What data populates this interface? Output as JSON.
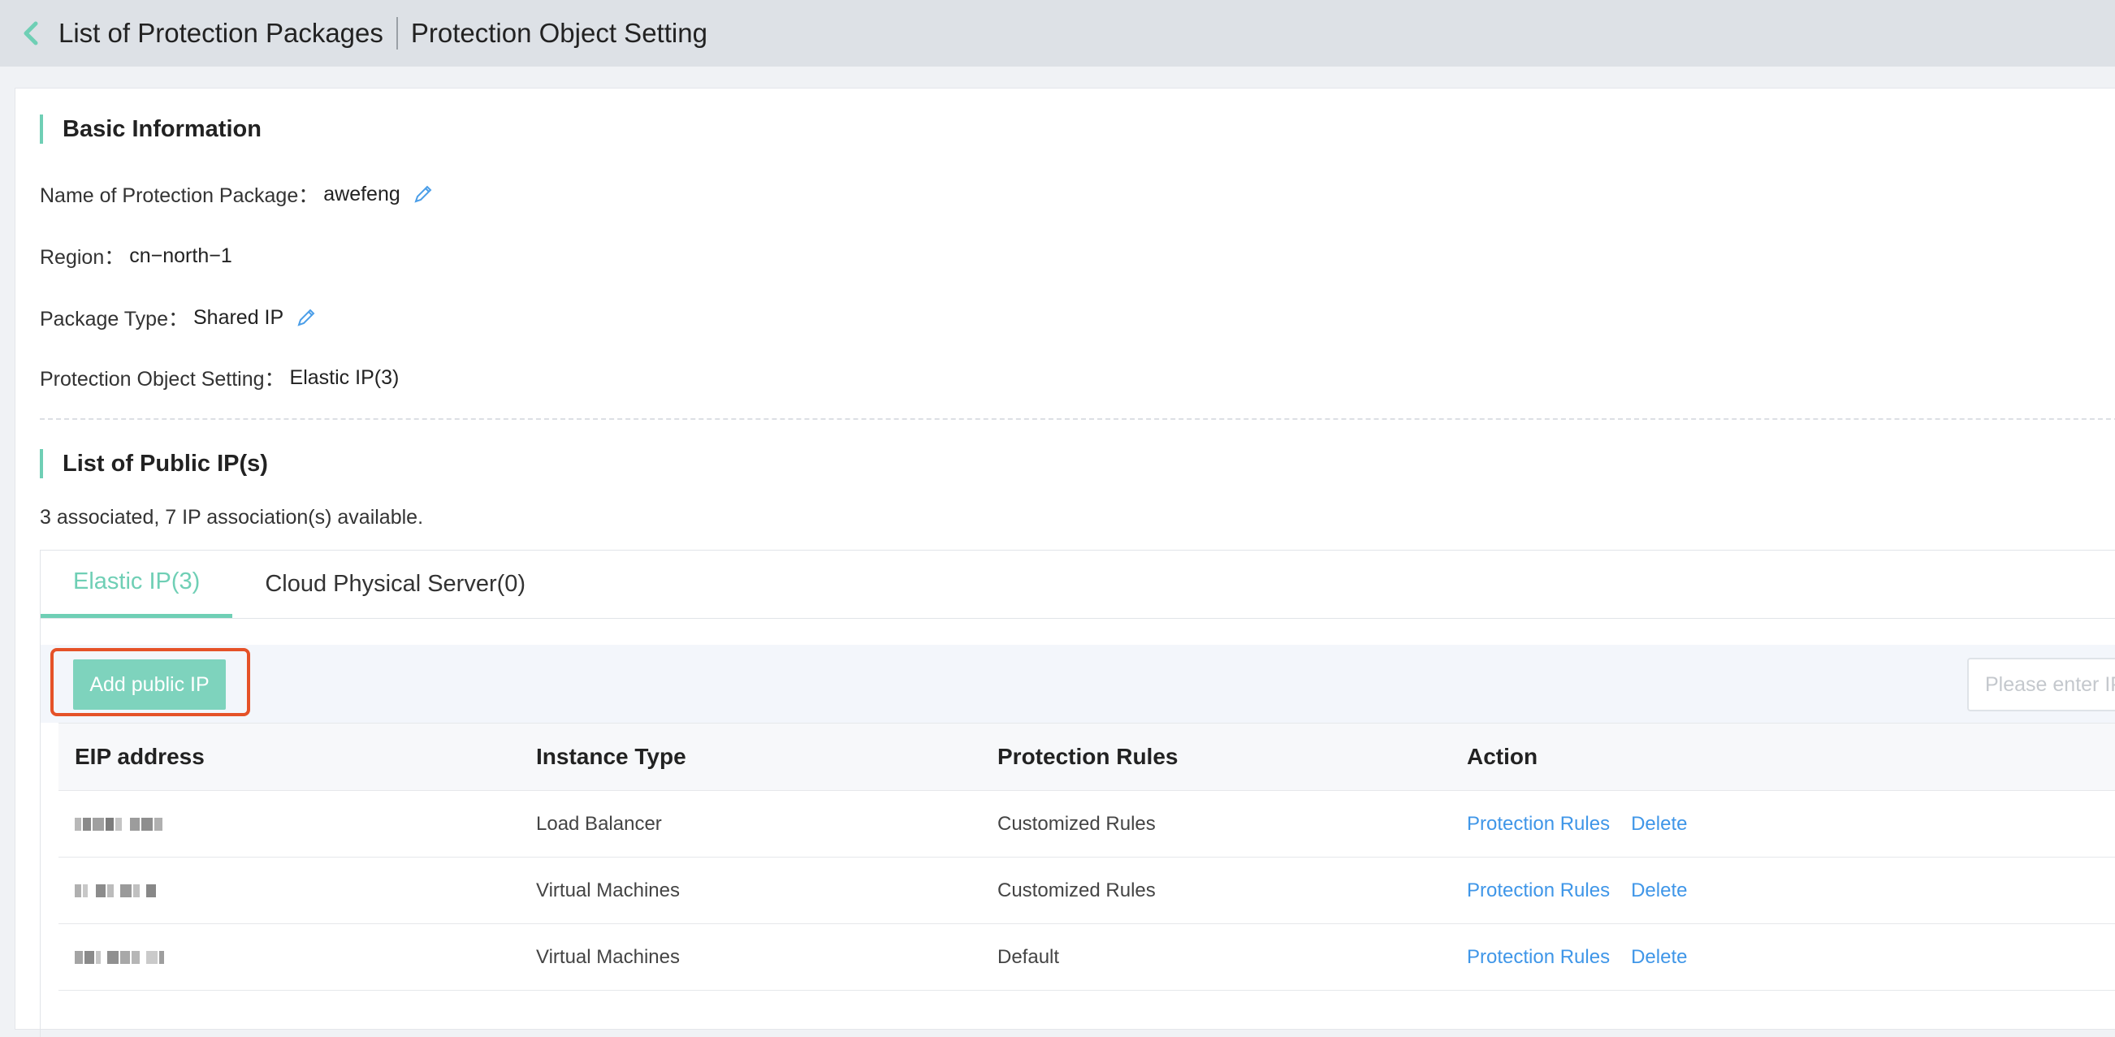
{
  "header": {
    "back_label": "List of Protection Packages",
    "current_label": "Protection Object Setting"
  },
  "basic": {
    "title": "Basic Information",
    "name_label": "Name of Protection Package：",
    "name_value": "awefeng",
    "region_label": "Region：",
    "region_value": "cn−north−1",
    "type_label": "Package Type：",
    "type_value": "Shared IP",
    "object_label": "Protection Object Setting：",
    "object_value": "Elastic IP(3)"
  },
  "public_ips": {
    "title": "List of Public IP(s)",
    "summary": "3 associated, 7 IP association(s) available.",
    "tabs": [
      {
        "label": "Elastic IP(3)",
        "active": true
      },
      {
        "label": "Cloud Physical Server(0)",
        "active": false
      }
    ],
    "add_button": "Add public IP",
    "search_placeholder": "Please enter IP t",
    "columns": [
      "EIP address",
      "Instance Type",
      "Protection Rules",
      "Action"
    ],
    "rows": [
      {
        "eip": "[blurred]",
        "instance_type": "Load Balancer",
        "rules": "Customized Rules",
        "actions": [
          "Protection Rules",
          "Delete"
        ]
      },
      {
        "eip": "[blurred]",
        "instance_type": "Virtual Machines",
        "rules": "Customized Rules",
        "actions": [
          "Protection Rules",
          "Delete"
        ]
      },
      {
        "eip": "[blurred]",
        "instance_type": "Virtual Machines",
        "rules": "Default",
        "actions": [
          "Protection Rules",
          "Delete"
        ]
      }
    ]
  },
  "colors": {
    "accent": "#6fcfb5",
    "link": "#3f96e8",
    "highlight": "#e55228",
    "header_bg": "#dde1e6"
  }
}
